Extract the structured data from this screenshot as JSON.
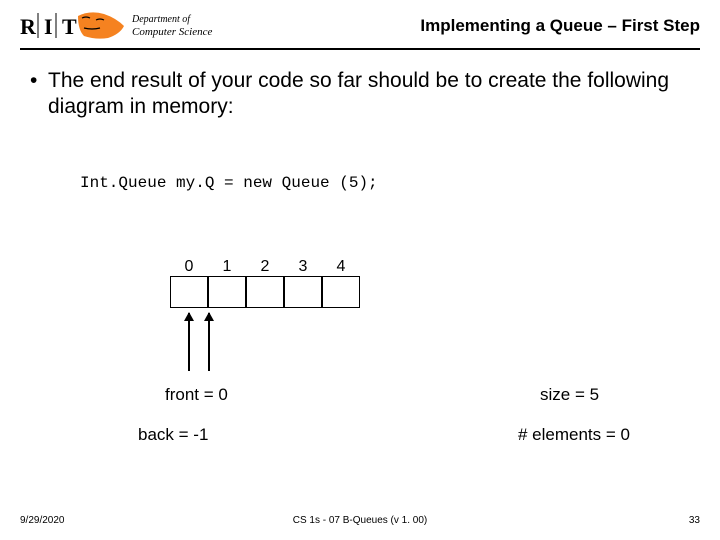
{
  "header": {
    "logo_alt": "RIT Department of Computer Science",
    "title": "Implementing a Queue – First Step"
  },
  "bullet": "The end result of your code so far should be to create the following diagram in memory:",
  "code": "Int.Queue my.Q = new Queue (5);",
  "array": {
    "indices": [
      "0",
      "1",
      "2",
      "3",
      "4"
    ]
  },
  "labels": {
    "front": "front = 0",
    "back": "back = -1",
    "size": "size = 5",
    "elements": "# elements = 0"
  },
  "footer": {
    "date": "9/29/2020",
    "center": "CS 1s - 07 B-Queues (v 1. 00)",
    "page": "33"
  }
}
